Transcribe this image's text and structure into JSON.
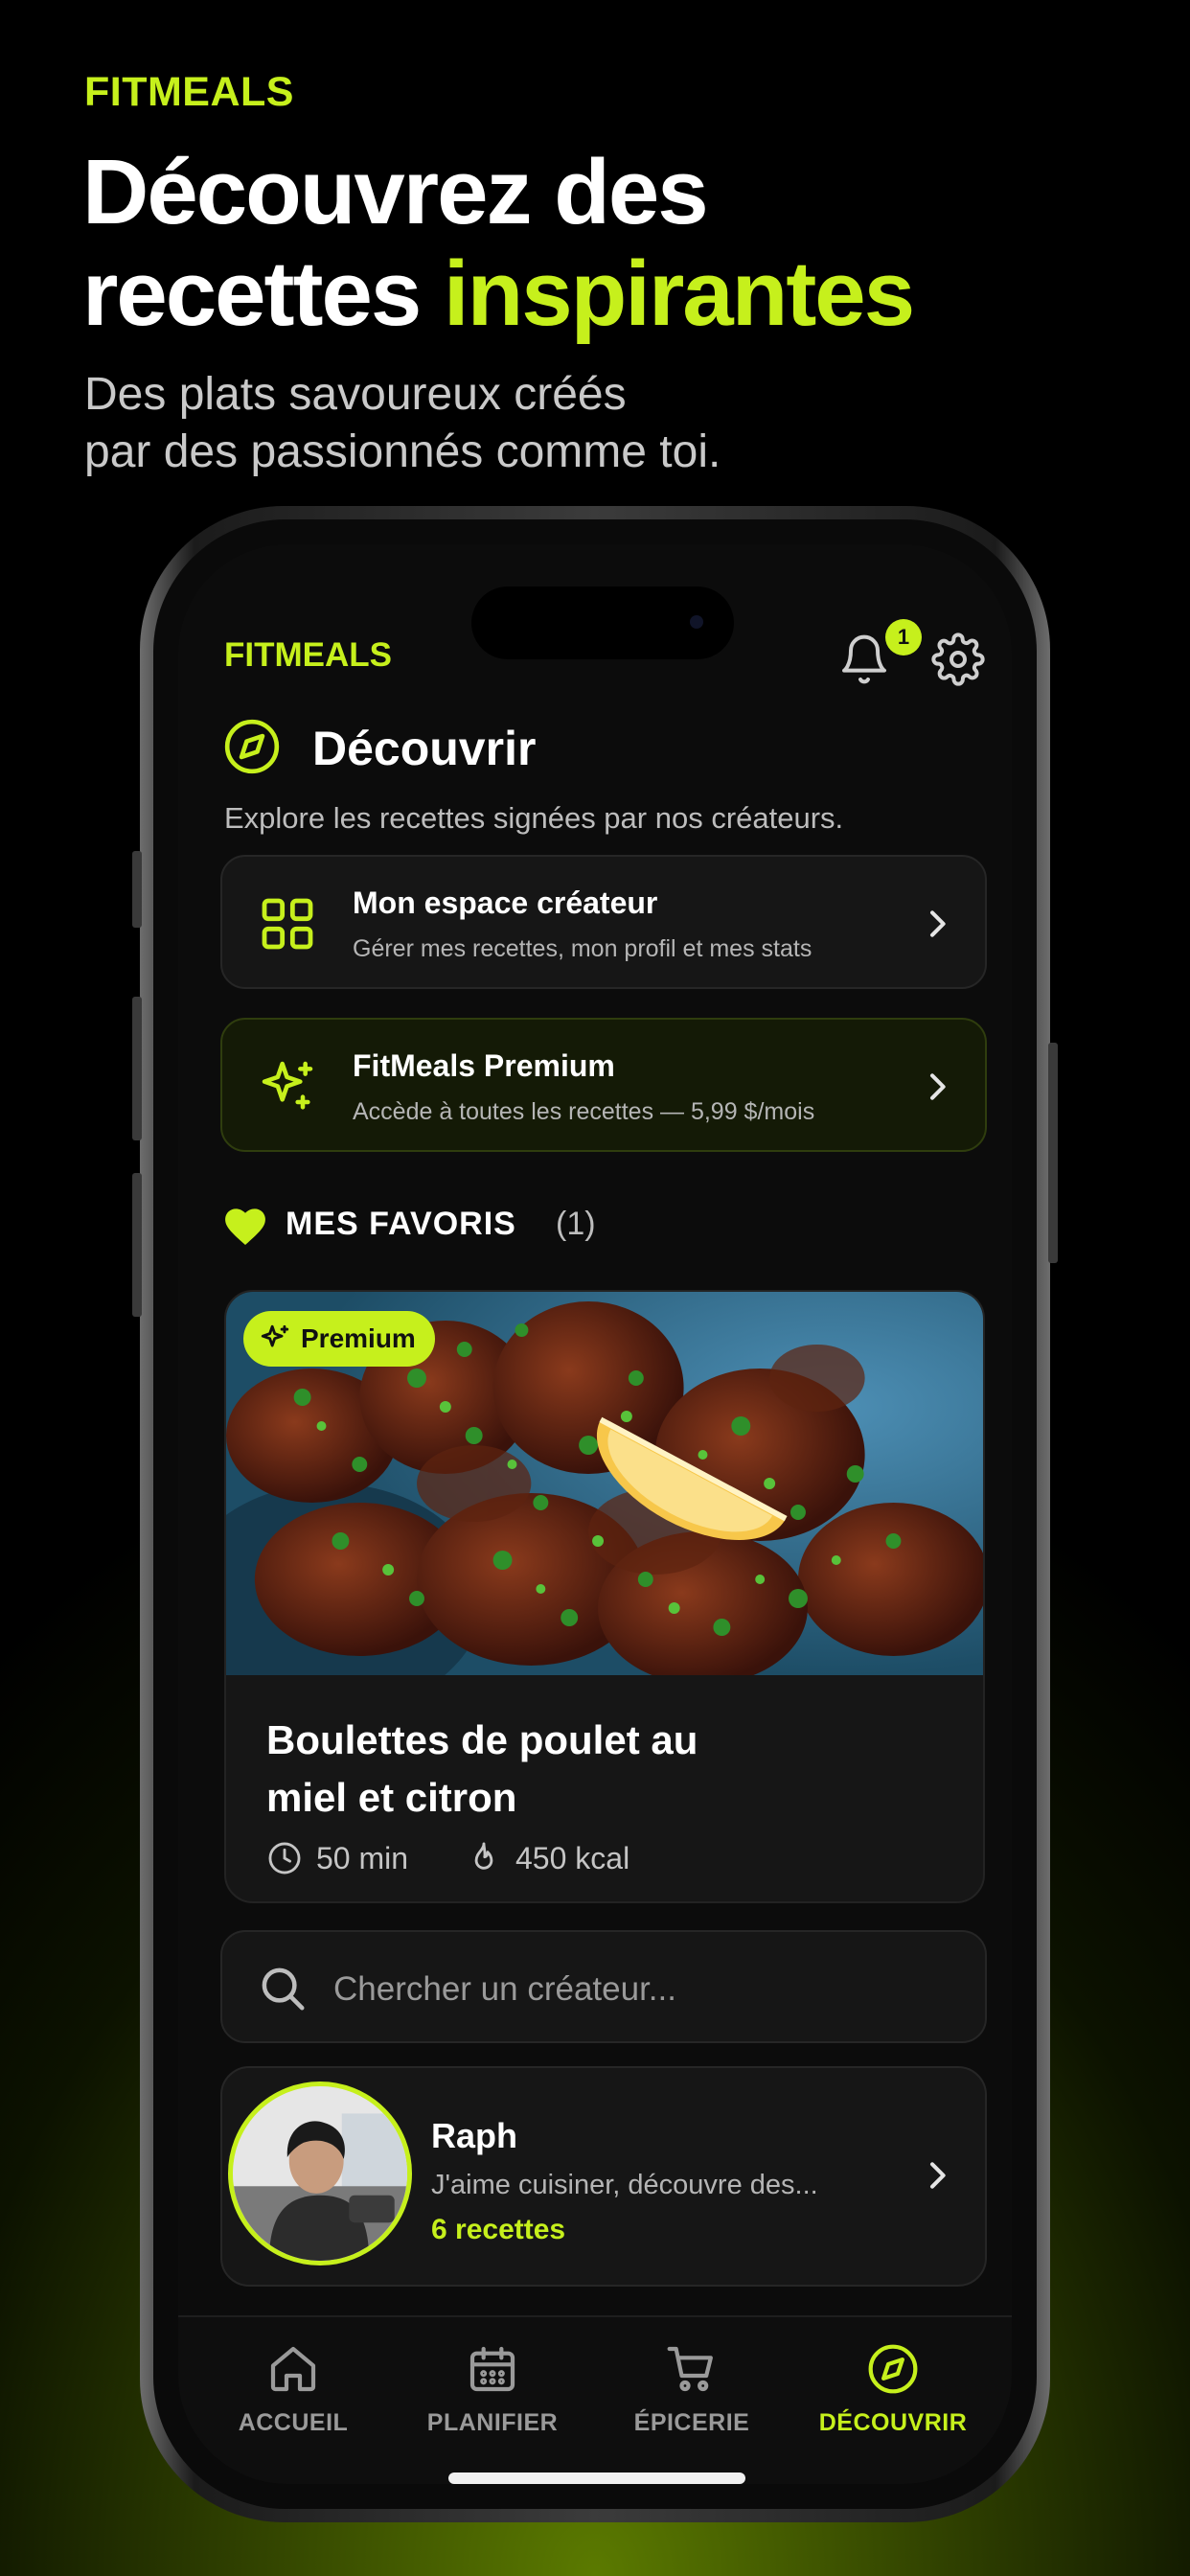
{
  "marketing": {
    "brand": "FITMEALS",
    "headline_line1": "Découvrez des",
    "headline_line2_plain": "recettes ",
    "headline_line2_accent": "inspirantes",
    "subtitle_line1": "Des plats savoureux créés",
    "subtitle_line2": "par des passionnés comme toi."
  },
  "app": {
    "brand": "FITMEALS",
    "notification_count": "1",
    "page_title": "Découvrir",
    "page_subtitle": "Explore les recettes signées par nos créateurs.",
    "creator_space": {
      "title": "Mon espace créateur",
      "subtitle": "Gérer mes recettes, mon profil et mes stats"
    },
    "premium_card": {
      "title": "FitMeals Premium",
      "subtitle": "Accède à toutes les recettes — 5,99 $/mois"
    },
    "favorites": {
      "label": "MES FAVORIS",
      "count": "(1)"
    },
    "recipe": {
      "badge": "Premium",
      "title_line1": "Boulettes de poulet au",
      "title_line2": "miel et citron",
      "time": "50 min",
      "calories": "450 kcal"
    },
    "search": {
      "placeholder": "Chercher un créateur..."
    },
    "creator": {
      "name": "Raph",
      "bio": "J'aime cuisiner, découvre des...",
      "recipes": "6 recettes"
    },
    "tabs": [
      {
        "label": "ACCUEIL",
        "icon": "home-icon",
        "active": false
      },
      {
        "label": "PLANIFIER",
        "icon": "calendar-icon",
        "active": false
      },
      {
        "label": "ÉPICERIE",
        "icon": "cart-icon",
        "active": false
      },
      {
        "label": "DÉCOUVRIR",
        "icon": "compass-icon",
        "active": true
      }
    ]
  },
  "colors": {
    "accent": "#c6f01c",
    "background": "#0c0c0c",
    "card": "#161616"
  }
}
